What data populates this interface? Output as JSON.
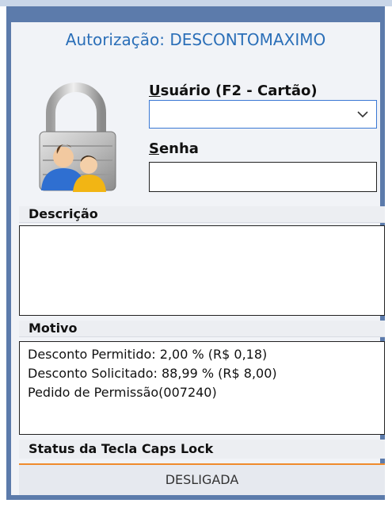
{
  "dialog": {
    "title": "Autorização: DESCONTOMAXIMO"
  },
  "form": {
    "usuario_label_underlined": "U",
    "usuario_label_rest": "suário (F2 - Cartão)",
    "usuario_value": "",
    "senha_label_underlined": "S",
    "senha_label_rest": "enha",
    "senha_value": ""
  },
  "descricao": {
    "header": "Descrição",
    "text": ""
  },
  "motivo": {
    "header": "Motivo",
    "lines": [
      "Desconto Permitido: 2,00 % (R$ 0,18)",
      "Desconto Solicitado: 88,99 % (R$ 8,00)",
      "Pedido de Permissão(007240)"
    ]
  },
  "caps_lock": {
    "header": "Status da Tecla Caps Lock",
    "status": "DESLIGADA"
  },
  "icons": {
    "lock": "padlock-users-icon",
    "dropdown": "chevron-down-icon"
  },
  "colors": {
    "title": "#2b6fb8",
    "frame": "#5c7bab",
    "focus_border": "#3a78d4",
    "caps_divider": "#f08b2c"
  }
}
